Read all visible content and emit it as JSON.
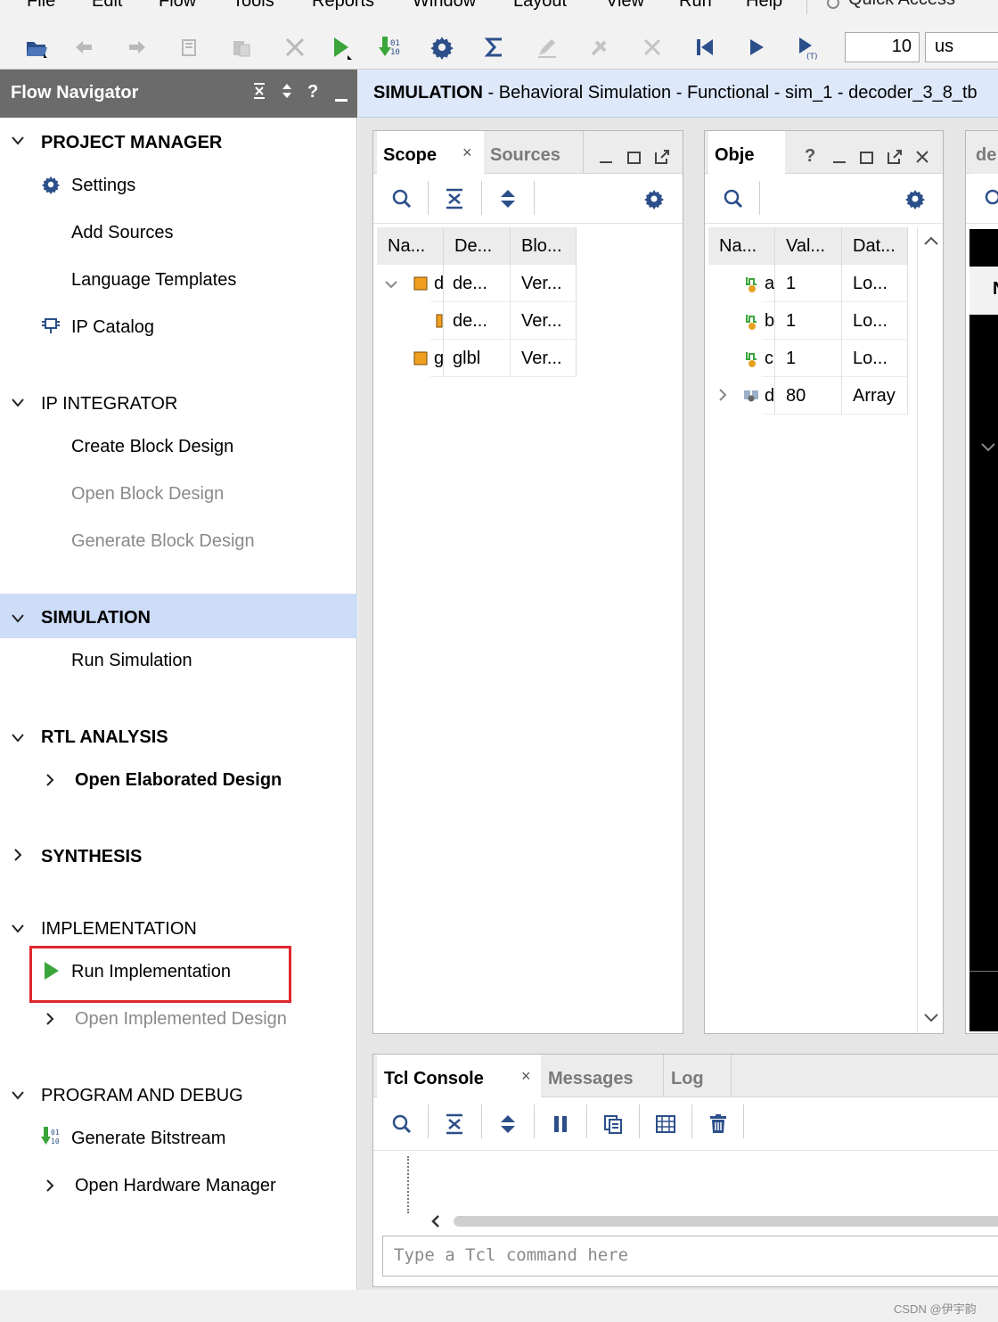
{
  "menu": {
    "items": [
      "File",
      "Edit",
      "Flow",
      "Tools",
      "Reports",
      "Window",
      "Layout",
      "View",
      "Run",
      "Help"
    ],
    "quick_access": "Quick Access"
  },
  "toolbar": {
    "sim_time_value": "10",
    "sim_time_unit": "us"
  },
  "flow_navigator": {
    "title": "Flow Navigator",
    "sections": {
      "project_manager": {
        "title": "PROJECT MANAGER",
        "settings": "Settings",
        "add_sources": "Add Sources",
        "language_templates": "Language Templates",
        "ip_catalog": "IP Catalog"
      },
      "ip_integrator": {
        "title": "IP INTEGRATOR",
        "create_block_design": "Create Block Design",
        "open_block_design": "Open Block Design",
        "generate_block_design": "Generate Block Design"
      },
      "simulation": {
        "title": "SIMULATION",
        "run_simulation": "Run Simulation"
      },
      "rtl_analysis": {
        "title": "RTL ANALYSIS",
        "open_elaborated_design": "Open Elaborated Design"
      },
      "synthesis": {
        "title": "SYNTHESIS"
      },
      "implementation": {
        "title": "IMPLEMENTATION",
        "run_implementation": "Run Implementation",
        "open_implemented_design": "Open Implemented Design"
      },
      "program_and_debug": {
        "title": "PROGRAM AND DEBUG",
        "generate_bitstream": "Generate Bitstream",
        "open_hardware_manager": "Open Hardware Manager"
      }
    }
  },
  "sim_header": {
    "prefix": "SIMULATION",
    "detail": " - Behavioral Simulation - Functional - sim_1 - decoder_3_8_tb"
  },
  "scope_panel": {
    "tabs": [
      "Scope",
      "Sources"
    ],
    "columns": [
      "Na...",
      "De...",
      "Blo..."
    ],
    "rows": [
      {
        "name": "d",
        "design": "de...",
        "block": "Ver..."
      },
      {
        "name": "",
        "design": "de...",
        "block": "Ver..."
      },
      {
        "name": "g",
        "design": "glbl",
        "block": "Ver..."
      }
    ]
  },
  "objects_panel": {
    "title": "Obje",
    "columns": [
      "Na...",
      "Val...",
      "Dat..."
    ],
    "rows": [
      {
        "name": "a",
        "value": "1",
        "type": "Lo..."
      },
      {
        "name": "b",
        "value": "1",
        "type": "Lo..."
      },
      {
        "name": "c",
        "value": "1",
        "type": "Lo..."
      },
      {
        "name": "d",
        "value": "80",
        "type": "Array"
      }
    ]
  },
  "wave_panel": {
    "title": "de",
    "marker": "N"
  },
  "console": {
    "tabs": [
      "Tcl Console",
      "Messages",
      "Log"
    ],
    "placeholder": "Type a Tcl command here"
  },
  "watermark": "CSDN @伊宇韵",
  "colors": {
    "nav_header": "#6b6b6b",
    "selected_section": "#cddcf7",
    "sim_header": "#dde8fb",
    "icon_blue": "#2c4f8a",
    "run_green": "#3aa53a",
    "highlight_red": "#e0262d"
  }
}
